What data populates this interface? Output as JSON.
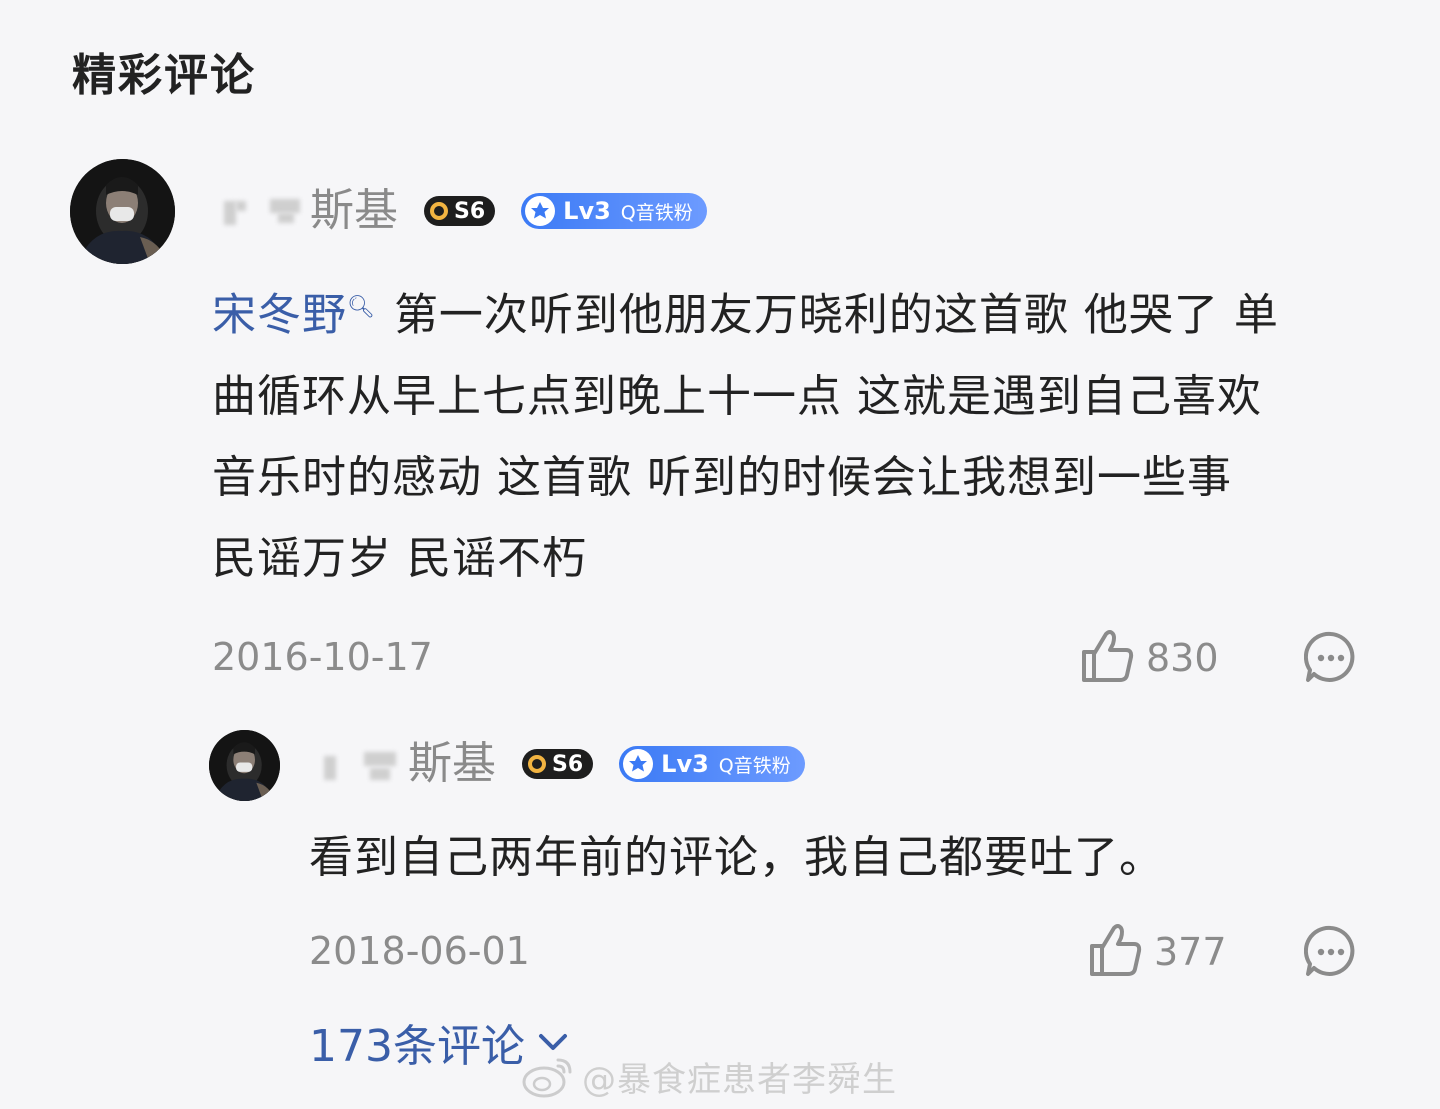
{
  "section": {
    "title": "精彩评论"
  },
  "comment": {
    "username": "斯基",
    "vip_level": "S6",
    "fan_level": "Lv3",
    "fan_label": "Q音铁粉",
    "mention": "宋冬野",
    "lines": [
      "第一次听到他朋友万晓利的这首歌 他哭了 单",
      "曲循环从早上七点到晚上十一点 这就是遇到自己喜欢",
      "音乐时的感动  这首歌 听到的时候会让我想到一些事",
      "民谣万岁 民谣不朽"
    ],
    "date": "2016-10-17",
    "likes": "830"
  },
  "reply": {
    "username": "斯基",
    "vip_level": "S6",
    "fan_level": "Lv3",
    "fan_label": "Q音铁粉",
    "text": "看到自己两年前的评论，我自己都要吐了。",
    "date": "2018-06-01",
    "likes": "377"
  },
  "more": {
    "label": "173条评论"
  },
  "watermark": {
    "text": "@暴食症患者李舜生"
  },
  "icons": {
    "like": "thumbs-up-icon",
    "comment": "comment-bubble-icon",
    "expand": "chevron-down-icon",
    "weibo": "weibo-logo-icon"
  },
  "colors": {
    "background": "#f6f6f8",
    "mention": "#3a5ea8",
    "fan_badge": "#3b7af5",
    "vip_ring": "#f2b441"
  }
}
